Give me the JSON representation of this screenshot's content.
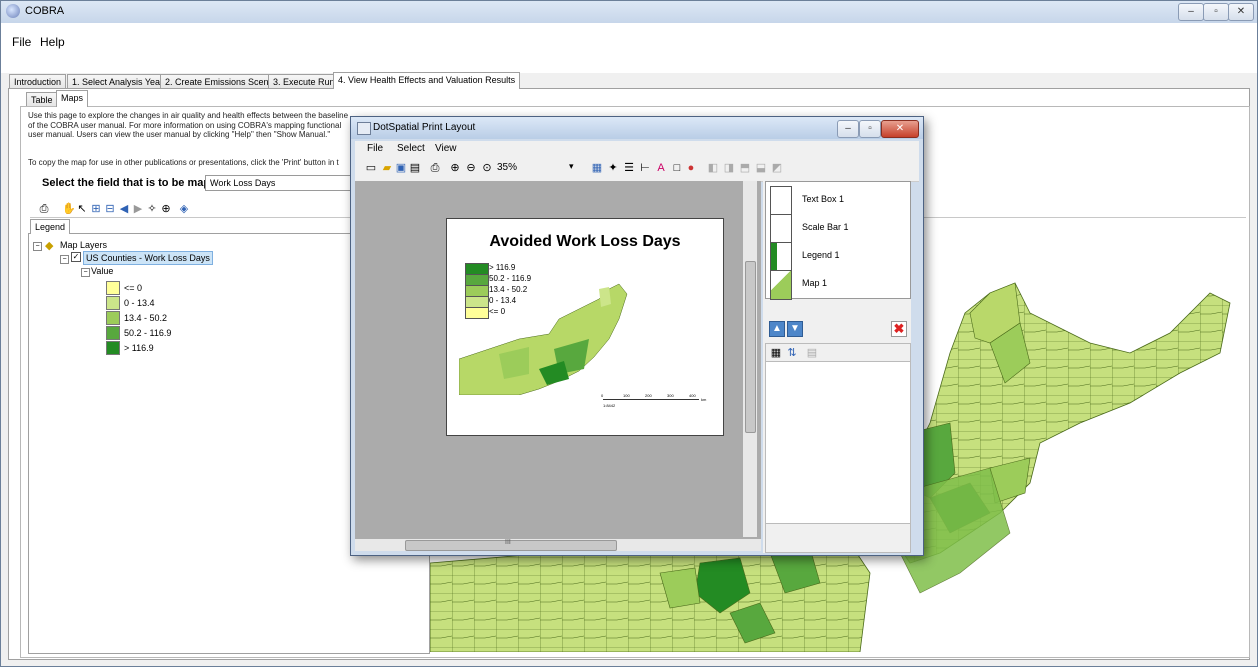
{
  "window": {
    "title": "COBRA"
  },
  "menu": [
    "File",
    "Help"
  ],
  "tabs": [
    "Introduction",
    "1. Select Analysis Year",
    "2. Create Emissions Scenario",
    "3. Execute Run",
    "4. View Health Effects and Valuation Results"
  ],
  "subtabs": [
    "Table",
    "Maps"
  ],
  "description": {
    "line1": "Use this page to explore the changes in air quality and health effects between the baseline",
    "line2": "of the COBRA user manual.  For more information on using COBRA's mapping functional",
    "line3": "user manual.  Users can view the user manual by clicking \"Help\" then \"Show Manual.\"",
    "line4": "To copy the map for use in other publications or presentations, click the 'Print' button in t"
  },
  "field_selector": {
    "label": "Select the field that is to be mapped:",
    "value": "Work Loss Days"
  },
  "legend_tab": "Legend",
  "layers": {
    "root": "Map Layers",
    "layer": "US Counties - Work Loss Days",
    "value_label": "Value",
    "classes": [
      {
        "label": "<= 0",
        "color": "#ffff99"
      },
      {
        "label": "0 - 13.4",
        "color": "#cce58a"
      },
      {
        "label": "13.4 - 50.2",
        "color": "#9ccc5a"
      },
      {
        "label": "50.2 - 116.9",
        "color": "#58a83e"
      },
      {
        "label": "> 116.9",
        "color": "#238b23"
      }
    ]
  },
  "print_layout": {
    "title": "DotSpatial Print Layout",
    "menu": [
      "File",
      "Select",
      "View"
    ],
    "zoom": "35%",
    "map_title": "Avoided Work Loss Days",
    "legend_entries": [
      "> 116.9",
      "50.2 - 116.9",
      "13.4 - 50.2",
      "0 - 13.4",
      "<= 0"
    ],
    "scale_bar": {
      "ticks": [
        "0",
        "100",
        "200",
        "300",
        "400"
      ],
      "unit": "km",
      "ratio": "1:8442"
    },
    "elements": [
      "Text Box 1",
      "Scale Bar 1",
      "Legend 1",
      "Map 1"
    ],
    "scrollbar_glyph": "III"
  }
}
